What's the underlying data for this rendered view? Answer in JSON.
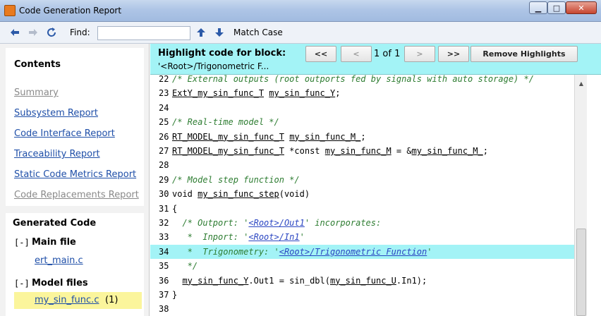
{
  "window": {
    "title": "Code Generation Report",
    "minimize": "▁",
    "maximize": "□",
    "close": "✕"
  },
  "toolbar": {
    "find_label": "Find:",
    "find_value": "",
    "match_case_label": "Match Case",
    "icons": [
      "back-arrow-icon",
      "forward-arrow-icon",
      "refresh-icon",
      "up-arrow-icon",
      "down-arrow-icon"
    ]
  },
  "contents": {
    "title": "Contents",
    "items": [
      {
        "label": "Summary",
        "enabled": false
      },
      {
        "label": "Subsystem Report",
        "enabled": true
      },
      {
        "label": "Code Interface Report",
        "enabled": true
      },
      {
        "label": "Traceability Report",
        "enabled": true
      },
      {
        "label": "Static Code Metrics Report",
        "enabled": true
      },
      {
        "label": "Code Replacements Report",
        "enabled": false
      }
    ]
  },
  "generated_code": {
    "title": "Generated Code",
    "groups": [
      {
        "toggle": "[-]",
        "label": "Main file",
        "files": [
          {
            "name": "ert_main.c",
            "count": ""
          }
        ]
      },
      {
        "toggle": "[-]",
        "label": "Model files",
        "files": [
          {
            "name": "my_sin_func.c",
            "count": "(1)"
          }
        ]
      }
    ]
  },
  "highlight": {
    "title": "Highlight code for block:",
    "block": "'<Root>/Trigonometric F...",
    "first_label": "<<",
    "prev_label": "<",
    "page_text": "1 of 1",
    "next_label": ">",
    "last_label": ">>",
    "remove_label": "Remove Highlights",
    "highlight_color": "#a3f3f6"
  },
  "code": {
    "lines": [
      {
        "n": "22",
        "hl": false,
        "segs": [
          [
            "cmt",
            "/* External outputs (root outports fed by signals with auto storage) */"
          ]
        ]
      },
      {
        "n": "23",
        "hl": false,
        "segs": [
          [
            "u",
            "ExtY_my_sin_func_T"
          ],
          [
            "",
            " "
          ],
          [
            "u",
            "my_sin_func_Y"
          ],
          [
            "",
            ";"
          ]
        ]
      },
      {
        "n": "24",
        "hl": false,
        "segs": []
      },
      {
        "n": "25",
        "hl": false,
        "segs": [
          [
            "cmt",
            "/* Real-time model */"
          ]
        ]
      },
      {
        "n": "26",
        "hl": false,
        "segs": [
          [
            "u",
            "RT_MODEL_my_sin_func_T"
          ],
          [
            "",
            " "
          ],
          [
            "u",
            "my_sin_func_M_"
          ],
          [
            "",
            ";"
          ]
        ]
      },
      {
        "n": "27",
        "hl": false,
        "segs": [
          [
            "u",
            "RT_MODEL_my_sin_func_T"
          ],
          [
            "",
            " *const "
          ],
          [
            "u",
            "my_sin_func_M"
          ],
          [
            "",
            " = &"
          ],
          [
            "u",
            "my_sin_func_M_"
          ],
          [
            "",
            ";"
          ]
        ]
      },
      {
        "n": "28",
        "hl": false,
        "segs": []
      },
      {
        "n": "29",
        "hl": false,
        "segs": [
          [
            "cmt",
            "/* Model step function */"
          ]
        ]
      },
      {
        "n": "30",
        "hl": false,
        "segs": [
          [
            "",
            "void "
          ],
          [
            "u",
            "my_sin_func_step"
          ],
          [
            "",
            "(void)"
          ]
        ]
      },
      {
        "n": "31",
        "hl": false,
        "segs": [
          [
            "",
            "{"
          ]
        ]
      },
      {
        "n": "32",
        "hl": false,
        "segs": [
          [
            "cmt",
            "  /* Outport: '"
          ],
          [
            "lnk",
            "<Root>/Out1"
          ],
          [
            "cmt",
            "' incorporates:"
          ]
        ]
      },
      {
        "n": "33",
        "hl": false,
        "segs": [
          [
            "cmt",
            "   *  Inport: '"
          ],
          [
            "lnk",
            "<Root>/In1"
          ],
          [
            "cmt",
            "'"
          ]
        ]
      },
      {
        "n": "34",
        "hl": true,
        "segs": [
          [
            "cmt",
            "   *  Trigonometry: '"
          ],
          [
            "lnk",
            "<Root>/Trigonometric Function"
          ],
          [
            "cmt",
            "'"
          ]
        ]
      },
      {
        "n": "35",
        "hl": false,
        "segs": [
          [
            "cmt",
            "   */"
          ]
        ]
      },
      {
        "n": "36",
        "hl": false,
        "segs": [
          [
            "",
            "  "
          ],
          [
            "u",
            "my_sin_func_Y"
          ],
          [
            "",
            ".Out1 = sin_dbl("
          ],
          [
            "u",
            "my_sin_func_U"
          ],
          [
            "",
            ".In1);"
          ]
        ]
      },
      {
        "n": "37",
        "hl": false,
        "segs": [
          [
            "",
            "}"
          ]
        ]
      },
      {
        "n": "38",
        "hl": false,
        "segs": []
      }
    ]
  }
}
